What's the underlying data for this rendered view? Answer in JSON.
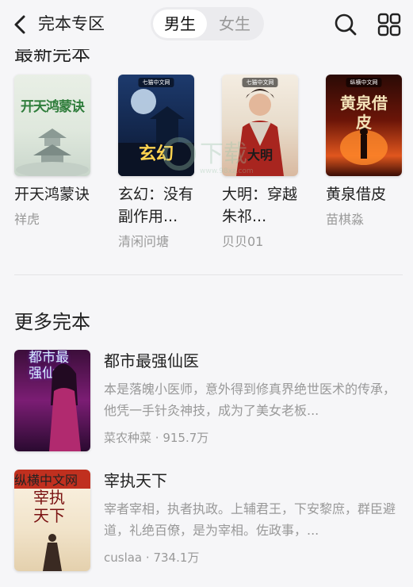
{
  "header": {
    "title": "完本专区",
    "tabs": [
      "男生",
      "女生"
    ],
    "active_tab": "男生"
  },
  "clipped_section_title": "最新完本",
  "new_books": [
    {
      "title": "开天鸿蒙诀",
      "author": "祥虎",
      "cover_text": "开天鸿蒙诀"
    },
    {
      "title": "玄幻：没有副作用...",
      "author": "清闲问塘",
      "cover_text": "玄幻"
    },
    {
      "title": "大明：穿越朱祁...",
      "author": "贝贝01",
      "cover_text": "大明"
    },
    {
      "title": "黄泉借皮",
      "author": "苗棋淼",
      "cover_text": "黄泉借皮"
    }
  ],
  "more_section_title": "更多完本",
  "more_books": [
    {
      "title": "都市最强仙医",
      "desc": "本是落魄小医师，意外得到修真界绝世医术的传承，他凭一手针灸神技，成为了美女老板...",
      "author": "菜农种菜",
      "count": "915.7万",
      "cover_text": "都市最强仙医"
    },
    {
      "title": "宰执天下",
      "desc": "宰者宰相，执者执政。上辅君王，下安黎庶，群臣避道，礼绝百僚，是为宰相。佐政事，...",
      "author": "cuslaa",
      "count": "734.1万",
      "cover_text": "宰执天下"
    }
  ],
  "watermark": "下载",
  "colors": {
    "background": "#f6f6f8",
    "text": "#222222",
    "muted": "#999999",
    "segment_bg": "#ebebee"
  }
}
